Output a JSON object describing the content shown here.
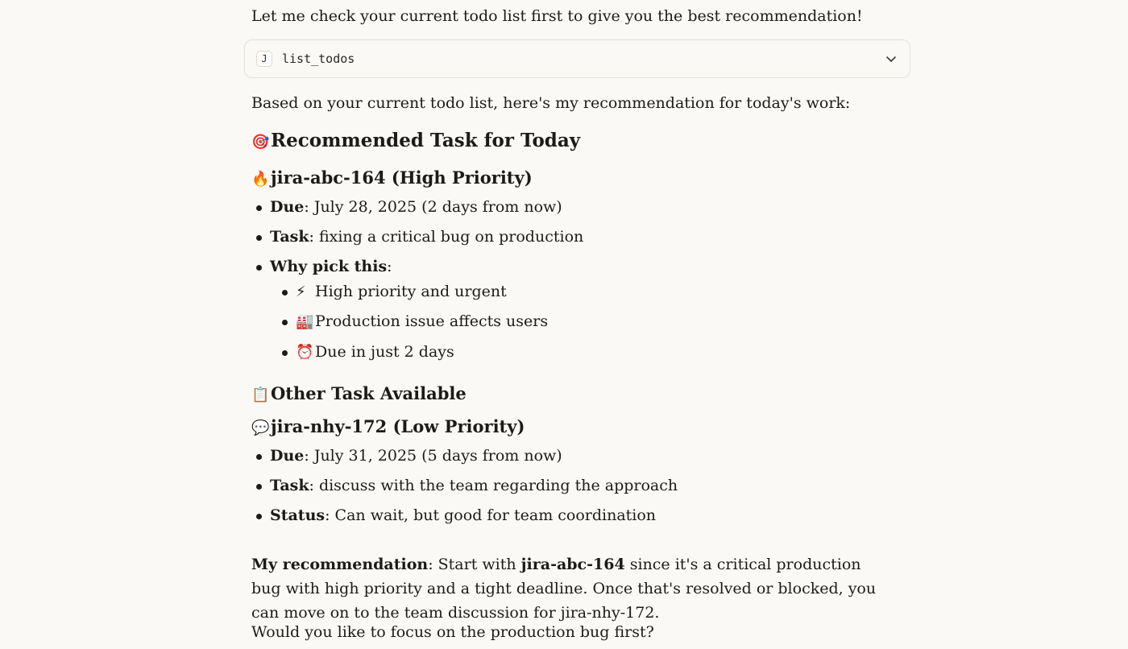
{
  "chat": {
    "intro": "Let me check your current todo list first to give you the best recommendation!",
    "tool_call": {
      "badge": "J",
      "name": "list_todos",
      "expand_icon": "chevron-down-icon"
    },
    "lead": "Based on your current todo list, here's my recommendation for today's work:",
    "section1": {
      "emoji": "🎯",
      "title": "Recommended Task for Today",
      "task": {
        "emoji": "🔥",
        "title": "jira-abc-164 (High Priority)",
        "due_label": "Due",
        "due_value": ": July 28, 2025 (2 days from now)",
        "task_label": "Task",
        "task_value": ": fixing a critical bug on production",
        "why_label": "Why pick this",
        "why_colon": ":",
        "reasons": [
          {
            "emoji": "⚡",
            "text": "High priority and urgent"
          },
          {
            "emoji": "🏭",
            "text": "Production issue affects users"
          },
          {
            "emoji": "⏰",
            "text": "Due in just 2 days"
          }
        ]
      }
    },
    "section2": {
      "emoji": "📋",
      "title": "Other Task Available",
      "task": {
        "emoji": "💬",
        "title": "jira-nhy-172 (Low Priority)",
        "due_label": "Due",
        "due_value": ": July 31, 2025 (5 days from now)",
        "task_label": "Task",
        "task_value": ": discuss with the team regarding the approach",
        "status_label": "Status",
        "status_value": ": Can wait, but good for team coordination"
      }
    },
    "recommendation": {
      "label": "My recommendation",
      "part1": ": Start with ",
      "ticket": "jira-abc-164",
      "part2": " since it's a critical production bug with high priority and a tight deadline. Once that's resolved or blocked, you can move on to the team discussion for jira-nhy-172."
    },
    "closing": "Would you like to focus on the production bug first?"
  }
}
